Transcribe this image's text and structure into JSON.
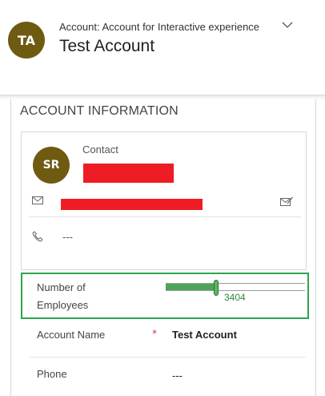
{
  "header": {
    "avatar_initials": "TA",
    "entity_line": "Account: Account for Interactive experience",
    "record_title": "Test Account"
  },
  "section": {
    "title": "ACCOUNT INFORMATION"
  },
  "contact_card": {
    "avatar_initials": "SR",
    "label": "Contact",
    "phone": "---"
  },
  "employees": {
    "label": "Number of Employees",
    "value_text": "3404",
    "slider_fraction": 0.36
  },
  "fields": {
    "account_name_label": "Account Name",
    "account_name_required": "*",
    "account_name_value": "Test Account",
    "phone_label": "Phone",
    "phone_value": "---"
  },
  "colors": {
    "avatar": "#6f5a12",
    "highlight_border": "#2ea44f",
    "redaction": "#ee1c25",
    "required": "#d13438"
  }
}
